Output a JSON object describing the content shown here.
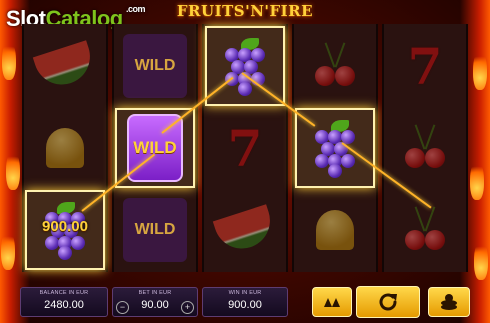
{
  "watermark": {
    "part1": "Slot",
    "part2": "Catalog",
    "suffix": ".com"
  },
  "game": {
    "title": "FRUITS'N'FIRE"
  },
  "reels": [
    [
      "watermelon",
      "bell",
      "grapes"
    ],
    [
      "wild",
      "wild",
      "wild"
    ],
    [
      "grapes",
      "seven",
      "watermelon"
    ],
    [
      "cherries",
      "grapes",
      "bell"
    ],
    [
      "seven",
      "cherries",
      "cherries"
    ]
  ],
  "symbols": {
    "wild_label": "WILD"
  },
  "win": {
    "amount_on_symbol": "900.00"
  },
  "footer": {
    "balance": {
      "label": "BALANCE IN EUR",
      "value": "2480.00"
    },
    "bet": {
      "label": "BET IN EUR",
      "value": "90.00",
      "minus": "−",
      "plus": "+"
    },
    "win": {
      "label": "WIN IN EUR",
      "value": "900.00"
    }
  },
  "colors": {
    "accent_gold": "#ffd23a",
    "panel_bg": "#1f122b",
    "wild_purple": "#9a3de6"
  }
}
